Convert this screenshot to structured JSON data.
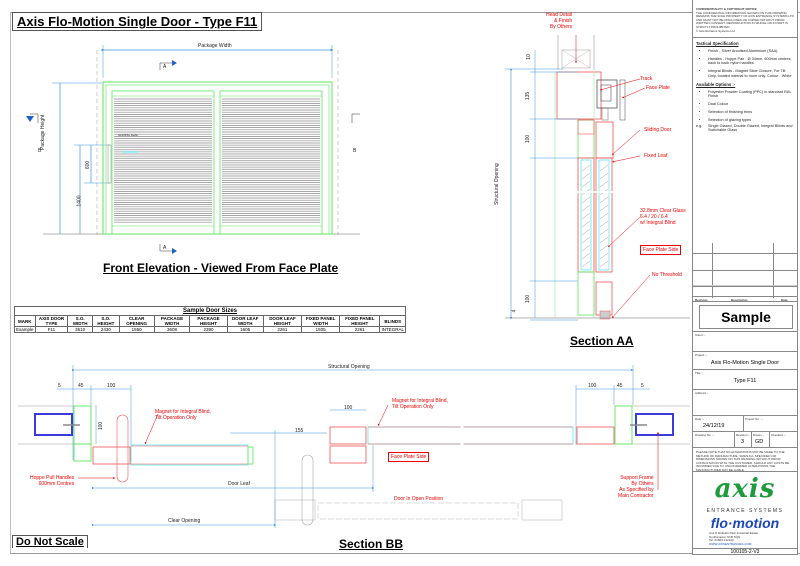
{
  "drawing_title": "Axis Flo-Motion Single Door - Type F11",
  "do_not_scale": "Do Not Scale",
  "front_elevation": {
    "title": "Front Elevation - Viewed From Face Plate",
    "package_width_label": "Package Width",
    "package_height_label": "Package Height",
    "dim_1400": "1400",
    "dim_600": "600",
    "sliding_leaf_label": "SLIDING LEAF",
    "section_marker_a": "A",
    "section_marker_b": "B"
  },
  "sample_table": {
    "caption": "Sample Door Sizes",
    "headers": [
      "MARK",
      "AXIS DOOR TYPE",
      "S.O. WIDTH",
      "S.O. HEIGHT",
      "CLEAR OPENING",
      "PACKAGE WIDTH",
      "PACKAGE HEIGHT",
      "DOOR LEAF WIDTH",
      "DOOR LEAF HEIGHT",
      "FIXED PANEL WIDTH",
      "FIXED PANEL HEIGHT",
      "BLINDS"
    ],
    "rows": [
      [
        "Example",
        "F11",
        "3610",
        "2430",
        "1550",
        "3608",
        "2390",
        "1605",
        "2261",
        "1505",
        "2261",
        "INTEGRAL"
      ]
    ]
  },
  "section_aa": {
    "title": "Section AA",
    "head_detail_note": "Head Detail\n& Finish\nBy Others",
    "track_label": "Track",
    "face_plate_label": "Face Plate",
    "sliding_door_label": "Sliding Door",
    "fixed_leaf_label": "Fixed Leaf",
    "glass_note": "32.8mm Clear Glass\n6.4 / 20 / 6.4\nw/ Integral Blind",
    "face_plate_side": "Face Plate Side",
    "no_threshold": "No Threshold",
    "structural_opening_label": "Structural Opening",
    "dims": [
      "10",
      "135",
      "100",
      "100",
      "4"
    ]
  },
  "section_bb": {
    "title": "Section BB",
    "structural_opening_label": "Structural Opening",
    "dims_left": [
      "5",
      "45",
      "100"
    ],
    "dims_right": [
      "100",
      "45",
      "5"
    ],
    "dim_100_vertical": "100",
    "dim_100_mid": "100",
    "dim_155": "155",
    "magnet_note_left": "Magnet for Integral Blind,\nTilt Operation Only",
    "magnet_note_right": "Magnet for Integral Blind,\nTilt Operation Only",
    "face_plate_side": "Face Plate Side",
    "hoppe_note": "Hoppe Pull Handles\n600mm Centres",
    "door_leaf_label": "Door Leaf",
    "clear_opening_label": "Clear Opening",
    "door_open_note": "Door In Open Position",
    "support_frame_note": "Support Frame\nBy Others\nAs Specified by\nMain Contractor"
  },
  "title_block": {
    "confidentiality_heading": "CONFIDENTIALITY & COPYRIGHT NOTICE",
    "confidentiality_text": "THE CONFIDENTIAL INFORMATION SHOWN ON THIS DRAWING REMAINS THE SOLE PROPERTY OF AXIS ENTRANCE SYSTEMS LTD AND MUST NOT BE DISCLOSED OR COPIED WITHOUT PRIOR WRITTEN CONSENT. REPRODUCTION IN WHOLE OR IN PART IS STRICTLY PROHIBITED.",
    "copyright": "© Axis Entrance Systems Ltd",
    "tactical_spec_heading": "Tactical Specification",
    "tactical_spec": [
      "Finish - Silver Anodised Aluminium (SAA)",
      "Handles - Hoppe Pair - Ø 34mm, 600mm centres, back to back nylon handles",
      "Integral Blinds - Magnet Slide Closure, For Tilt Only, located internal to room only. Colour - White"
    ],
    "options_heading": "Available Options :-",
    "options": [
      "Polyester Powder Coating (PPC) in standard RAL Finish",
      "Dual Colour",
      "Selection of finishing trims",
      "Selection of glazing types"
    ],
    "options_eg_prefix": "e.g.",
    "options_eg": "Single Glazed, Double Glazed, Integral Blinds and Switchable Glass",
    "revision_header": [
      "Revision",
      "Description",
      "Date"
    ],
    "status": "Sample",
    "client_label": "Client :-",
    "client_value": "",
    "project_label": "Project :-",
    "project_value": "Axis Flo-Motion Single Door",
    "title_label": "Title :-",
    "title_value": "Type F11",
    "address_label": "Address :-",
    "date_label": "Date :-",
    "date_value": "24/12/19",
    "project_no_label": "Project No. :-",
    "drawing_no_label": "Drawing No. :-",
    "revision_label": "Revision :-",
    "revision_value": "3",
    "drawn_label": "Drawn :-",
    "drawn_value": "GD",
    "checked_label": "Checked :-",
    "note": "PLEASE NOTE THAT NO ALTERATIONS MAY BE MADE TO THE METHOD OF MANUFACTURE, SIZES ALL SPECIFIED OR DIMENSIONS SHOWN ON THIS DRAWING WITHOUT PRIOR CONSULTATION WITH THE CUSTOMER. SHOULD ANY COSTS BE INCURRED DUE TO UNCONFIRMED ALTERATIONS THE MANUFACTURER MAY BE LIABLE.",
    "logo_axis": "axis",
    "logo_tagline": "ENTRANCE SYSTEMS",
    "logo_flomotion": "flo·motion",
    "address_lines": [
      "Unit 8 Sixfields Park Industrial Estate",
      "Northampton NN5 5QN",
      "Tel: 01604 212120"
    ],
    "website": "WWW.AXISENTRANCES.COM",
    "drawing_number": "100105-2-V3"
  },
  "colors": {
    "frame_green": "#5ee65e",
    "dimension_blue": "#3d93e0",
    "annotation_red": "#e00000",
    "glass_cyan": "#5fe8ef",
    "logo_green": "#1e9b3a",
    "logo_blue": "#1b46b8"
  }
}
